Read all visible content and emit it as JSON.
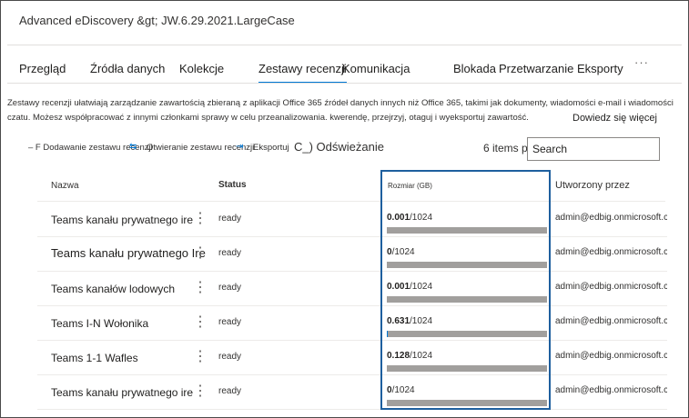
{
  "header": {
    "title": "Advanced eDiscovery &gt; JW.6.29.2021.LargeCase"
  },
  "tabs": [
    {
      "label": "Przegląd"
    },
    {
      "label": "Źródła danych"
    },
    {
      "label": "Kolekcje"
    },
    {
      "label": "Zestawy recenzji"
    },
    {
      "label": "Komunikacja"
    },
    {
      "label": "Blokada"
    },
    {
      "label": "Przetwarzanie"
    },
    {
      "label": "Eksporty"
    }
  ],
  "more_label": "···",
  "description": "Zestawy recenzji ułatwiają zarządzanie zawartością zbieraną z aplikacji Office 365 źródeł danych innych niż Office 365, takimi jak dokumenty, wiadomości e-mail i wiadomości czatu. Możesz współpracować z innymi członkami sprawy w celu przeanalizowania. kwerendę, przejrzyj, otaguj i wyeksportuj zawartość.",
  "learn_more": "Dowiedz się więcej",
  "toolbar": {
    "add": "– F Dodawanie zestawu recenzji",
    "open": "Otwieranie zestawu recenzji",
    "export": "Eksportuj",
    "refresh": "C_) Odświeżanie"
  },
  "items_count": "6 items p",
  "search": {
    "placeholder": "Search"
  },
  "columns": {
    "name": "Nazwa",
    "status": "Status",
    "size": "Rozmiar (GB)",
    "created_by": "Utworzony przez"
  },
  "rows": [
    {
      "name": "Teams kanału prywatnego ire",
      "status": "ready",
      "size_used": "0.001",
      "size_total": "/1024",
      "usage_fraction": 1e-06,
      "created_by": "admin@edbig.onmicrosoft.c"
    },
    {
      "name": "Teams kanału prywatnego Ire",
      "status": "ready",
      "size_used": "0",
      "size_total": "/1024",
      "usage_fraction": 0,
      "created_by": "admin@edbig.onmicrosoft.c"
    },
    {
      "name": "Teams kanałów lodowych",
      "status": "ready",
      "size_used": "0.001",
      "size_total": "/1024",
      "usage_fraction": 1e-06,
      "created_by": "admin@edbig.onmicrosoft.c"
    },
    {
      "name": "Teams I-N Wołonika",
      "status": "ready",
      "size_used": "0.631",
      "size_total": "/1024",
      "usage_fraction": 0.0006,
      "created_by": "admin@edbig.onmicrosoft.c"
    },
    {
      "name": "Teams 1-1 Wafles",
      "status": "ready",
      "size_used": "0.128",
      "size_total": "/1024",
      "usage_fraction": 0.0001,
      "created_by": "admin@edbig.onmicrosoft.c"
    },
    {
      "name": "Teams kanału prywatnego ire",
      "status": "ready",
      "size_used": "0",
      "size_total": "/1024",
      "usage_fraction": 0,
      "created_by": "admin@edbig.onmicrosoft.c"
    }
  ],
  "row_action_icon": "more-vertical-icon",
  "colors": {
    "accent": "#0078d4",
    "bar": "#a19f9d",
    "highlight": "#1e5f9e"
  }
}
